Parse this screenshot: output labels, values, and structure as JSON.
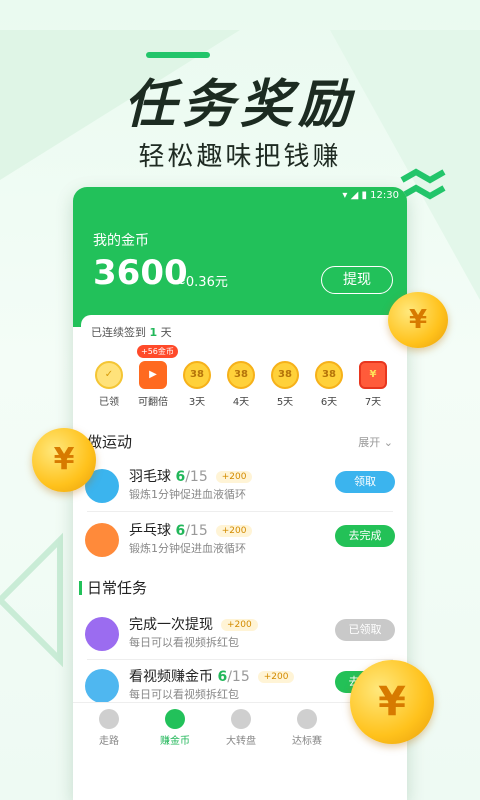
{
  "headline": "任务奖励",
  "subline": "轻松趣味把钱赚",
  "status_time": "12:30",
  "wallet": {
    "label": "我的金币",
    "coins": "3600",
    "approx": "≈0.36元",
    "withdraw": "提现"
  },
  "signin": {
    "streak_prefix": "已连续签到",
    "streak_days": "1",
    "streak_suffix": "天",
    "badge": "+56金币",
    "days": [
      {
        "coin": "✓",
        "label": "已领"
      },
      {
        "coin": "▶",
        "label": "可翻倍"
      },
      {
        "coin": "38",
        "label": "3天"
      },
      {
        "coin": "38",
        "label": "4天"
      },
      {
        "coin": "38",
        "label": "5天"
      },
      {
        "coin": "38",
        "label": "6天"
      },
      {
        "coin": "¥",
        "label": "7天"
      }
    ]
  },
  "sport": {
    "title": "做运动",
    "expand": "展开",
    "tasks": [
      {
        "name": "羽毛球",
        "done": "6",
        "total": "/15",
        "reward": "+200",
        "desc": "锻炼1分钟促进血液循环",
        "button": "领取",
        "color": "#3bb4ee"
      },
      {
        "name": "乒乓球",
        "done": "6",
        "total": "/15",
        "reward": "+200",
        "desc": "锻炼1分钟促进血液循环",
        "button": "去完成",
        "color": "#23c157"
      }
    ]
  },
  "daily": {
    "title": "日常任务",
    "tasks": [
      {
        "name": "完成一次提现",
        "reward": "+200",
        "desc": "每日可以看视频拆红包",
        "button": "已领取",
        "color": "#c9c9c9"
      },
      {
        "name": "看视频赚金币",
        "done": "6",
        "total": "/15",
        "reward": "+200",
        "desc": "每日可以看视频拆红包",
        "button": "去完成",
        "color": "#23c157"
      }
    ]
  },
  "tabs": [
    "走路",
    "赚金币",
    "大转盘",
    "达标赛"
  ],
  "colors": {
    "brand": "#22c15a",
    "accent": "#ffc21c"
  }
}
